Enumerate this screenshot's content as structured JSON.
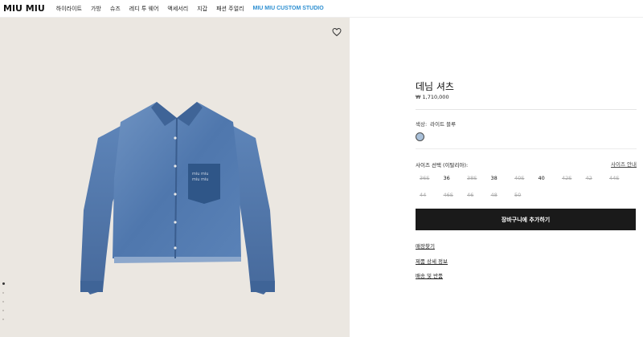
{
  "nav": {
    "logo": "MIU MIU",
    "items": [
      "하이라이트",
      "가방",
      "슈즈",
      "레디 투 웨어",
      "액세서리",
      "지갑",
      "패션 주얼리"
    ],
    "custom": "MIU MIU CUSTOM STUDIO",
    "accent_color": "#2d8fd1"
  },
  "product": {
    "title": "데님 셔츠",
    "price": "₩ 1,710,000",
    "color_label": "색상:",
    "color_value": "라이트 블루",
    "size_label": "사이즈 선택 (이탈리아):",
    "size_guide": "사이즈 안내",
    "sizes": [
      {
        "label": "36S",
        "available": false
      },
      {
        "label": "36",
        "available": true
      },
      {
        "label": "38S",
        "available": false
      },
      {
        "label": "38",
        "available": true
      },
      {
        "label": "40S",
        "available": false
      },
      {
        "label": "40",
        "available": true
      },
      {
        "label": "42S",
        "available": false
      },
      {
        "label": "42",
        "available": false
      },
      {
        "label": "44S",
        "available": false
      },
      {
        "label": "44",
        "available": false
      },
      {
        "label": "46S",
        "available": false
      },
      {
        "label": "46",
        "available": false
      },
      {
        "label": "48",
        "available": false
      },
      {
        "label": "50",
        "available": false
      }
    ],
    "add_to_cart": "장바구니에 추가하기",
    "links": [
      "매장찾기",
      "제품 상세 정보",
      "배송 및 반품"
    ]
  },
  "gallery": {
    "image_count": 5,
    "active_index": 0,
    "icons": {
      "favorite": "heart-icon"
    }
  }
}
